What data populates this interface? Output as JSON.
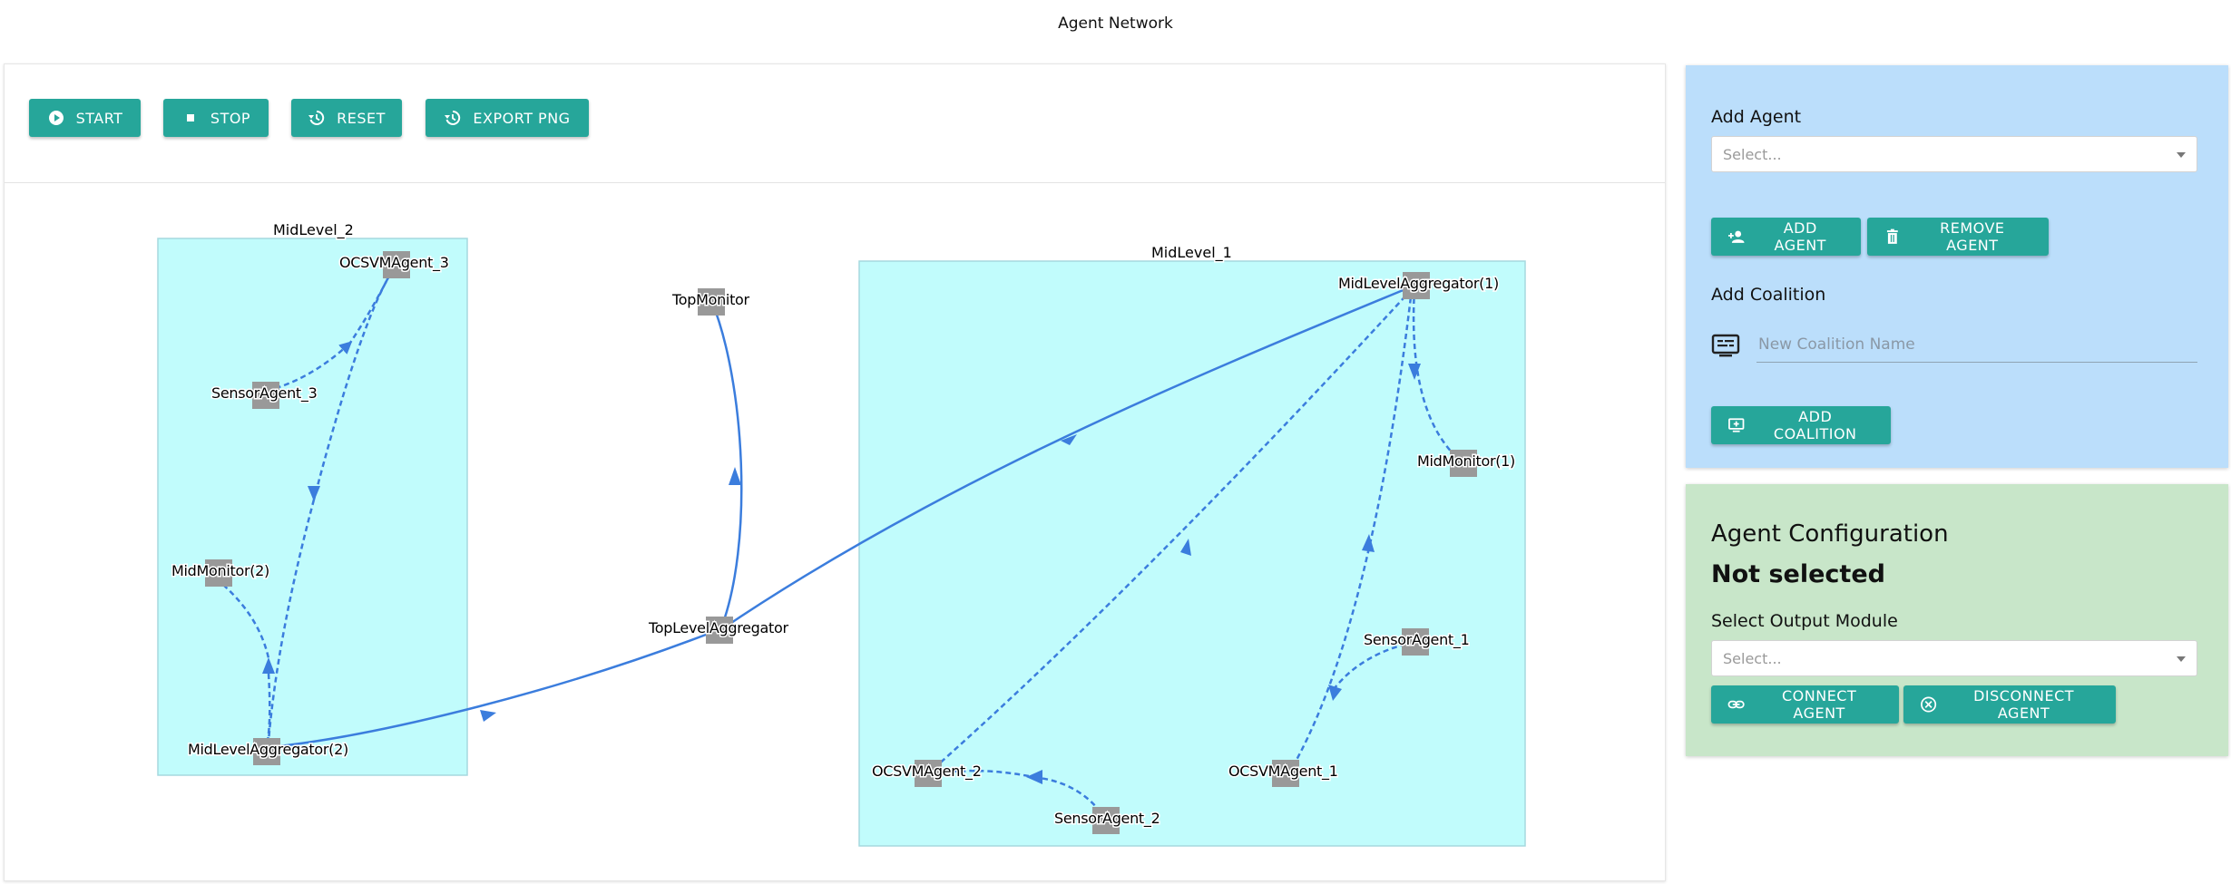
{
  "app": {
    "title": "Agent Network"
  },
  "toolbar": {
    "start": "START",
    "stop": "STOP",
    "reset": "RESET",
    "export": "EXPORT PNG"
  },
  "graph": {
    "groups": [
      "MidLevel_2",
      "MidLevel_1"
    ],
    "nodes": [
      "OCSVMAgent_3",
      "SensorAgent_3",
      "MidMonitor(2)",
      "MidLevelAggregator(2)",
      "TopMonitor",
      "TopLevelAggregator",
      "MidLevelAggregator(1)",
      "MidMonitor(1)",
      "SensorAgent_1",
      "OCSVMAgent_1",
      "OCSVMAgent_2",
      "SensorAgent_2"
    ],
    "colors": {
      "group_fill": "#c1fcfc",
      "group_border": "#a6d9df",
      "node_fill": "#999999",
      "edge": "#3b7ddd"
    }
  },
  "panel": {
    "add_agent_label": "Add Agent",
    "add_agent_placeholder": "Select...",
    "add_agent_button": "ADD AGENT",
    "remove_agent_button": "REMOVE AGENT",
    "add_coalition_label": "Add Coalition",
    "coalition_placeholder": "New Coalition Name",
    "add_coalition_button": "ADD COALITION"
  },
  "config": {
    "title": "Agent Configuration",
    "selected": "Not selected",
    "output_label": "Select Output Module",
    "output_placeholder": "Select...",
    "connect_button": "CONNECT AGENT",
    "disconnect_button": "DISCONNECT AGENT"
  },
  "colors": {
    "accent": "#26a69a",
    "card_blue": "#bbdefb",
    "card_green": "#c8e6c9"
  }
}
